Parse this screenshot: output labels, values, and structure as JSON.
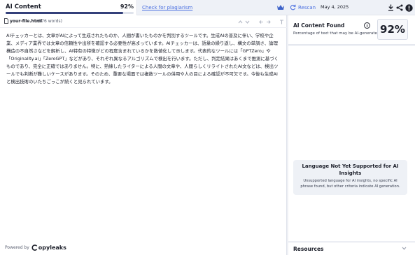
{
  "tabs": {
    "ai_content_label": "AI Content",
    "ai_content_percent": "92%",
    "ai_content_progress": 0.92,
    "plagiarism_link": "Check for plagiarism"
  },
  "toolbar": {
    "rescan_label": "Rescan",
    "date": "May 4, 2025",
    "icons": [
      "crown-icon",
      "refresh-icon",
      "download-icon",
      "share-icon",
      "alert-icon"
    ]
  },
  "document": {
    "file_name": "your-file.html",
    "word_count": "(376 words)",
    "text": "AIチェッカーとは、文章がAIによって生成されたものか、人間が書いたものかを判別するツールです。生成AIの普及に伴い、学校や企業、メディア業界では文章の信頼性や出所を確認する必要性が高まっています。AIチェッカーは、語彙の繰り返し、構文の単調さ、論理構造の不自然さなどを解析し、AI特有の特徴がどの程度含まれているかを数値化して示します。代表的なツールには「GPTZero」や「Originality.ai」「ZeroGPT」などがあり、それぞれ異なるアルゴリズムで検出を行います。ただし、判定結果はあくまで推測に基づくものであり、完全に正確ではありません。特に、熟練したライターによる人間の文章や、人間らしくリライトされたAI文などは、検出ツールでも判断が難しいケースがあります。そのため、重要な場面では複数ツールの併用や人の目による確認が不可欠です。今後も生成AIと検出技術のいたちごっこが続くと見られています。",
    "powered_by": "Powered by",
    "brand": "opyleaks"
  },
  "result": {
    "title": "AI Content Found",
    "subtitle": "Percentage of text that may be AI-generated",
    "percent": "92%"
  },
  "notice": {
    "title": "Language Not Yet Supported for AI Insights",
    "body": "Unsupported language for AI insights, no specific AI phrase found, but other criteria indicate AI generation."
  },
  "resources": {
    "label": "Resources"
  },
  "colors": {
    "accent": "#4a6fe0",
    "progress": "#34407a",
    "crown": "#3e63c9"
  }
}
